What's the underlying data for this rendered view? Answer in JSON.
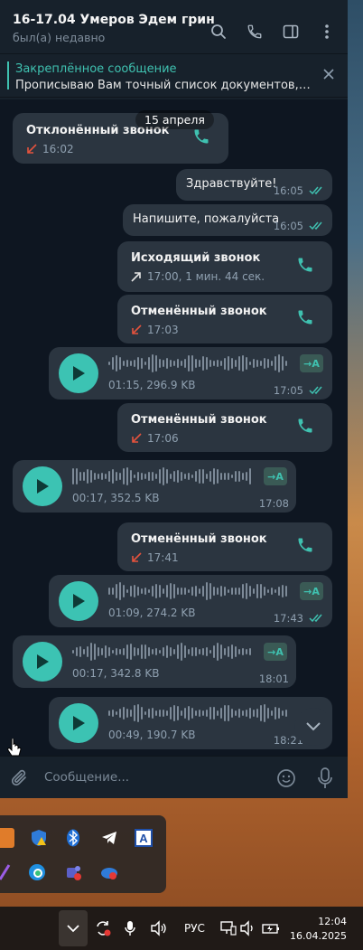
{
  "header": {
    "title": "16-17.04 Умеров Эдем грин",
    "status": "был(а) недавно"
  },
  "pinned": {
    "title": "Закреплённое сообщение",
    "text": "Прописываю Вам точный список документов, о..."
  },
  "date_pill": "15 апреля",
  "messages": {
    "m1": {
      "title": "Отклонённый звонок",
      "time": "16:02"
    },
    "m2": {
      "text": "Здравствуйте!",
      "time": "16:05"
    },
    "m3": {
      "text": "Напишите, пожалуйста",
      "time": "16:05"
    },
    "m4": {
      "title": "Исходящий звонок",
      "meta": "17:00, 1 мин. 44 сек."
    },
    "m5": {
      "title": "Отменённый звонок",
      "time": "17:03"
    },
    "m6": {
      "meta": "01:15, 296.9 KB",
      "time": "17:05",
      "tr": "→A"
    },
    "m7": {
      "title": "Отменённый звонок",
      "time": "17:06"
    },
    "m8": {
      "meta": "00:17, 352.5 KB",
      "time": "17:08",
      "tr": "→A"
    },
    "m9": {
      "title": "Отменённый звонок",
      "time": "17:41"
    },
    "m10": {
      "meta": "01:09, 274.2 KB",
      "time": "17:43",
      "tr": "→A"
    },
    "m11": {
      "meta": "00:17, 342.8 KB",
      "time": "18:01",
      "tr": "→A"
    },
    "m12": {
      "meta": "00:49, 190.7 KB",
      "time": "18:21"
    }
  },
  "composer": {
    "placeholder": "Сообщение..."
  },
  "taskbar": {
    "lang": "РУС",
    "time": "12:04",
    "date": "16.04.2025"
  },
  "colors": {
    "accent": "#3fc1b0",
    "missed": "#e5533d",
    "bg": "#0e1621",
    "bubble": "#2b3540"
  }
}
